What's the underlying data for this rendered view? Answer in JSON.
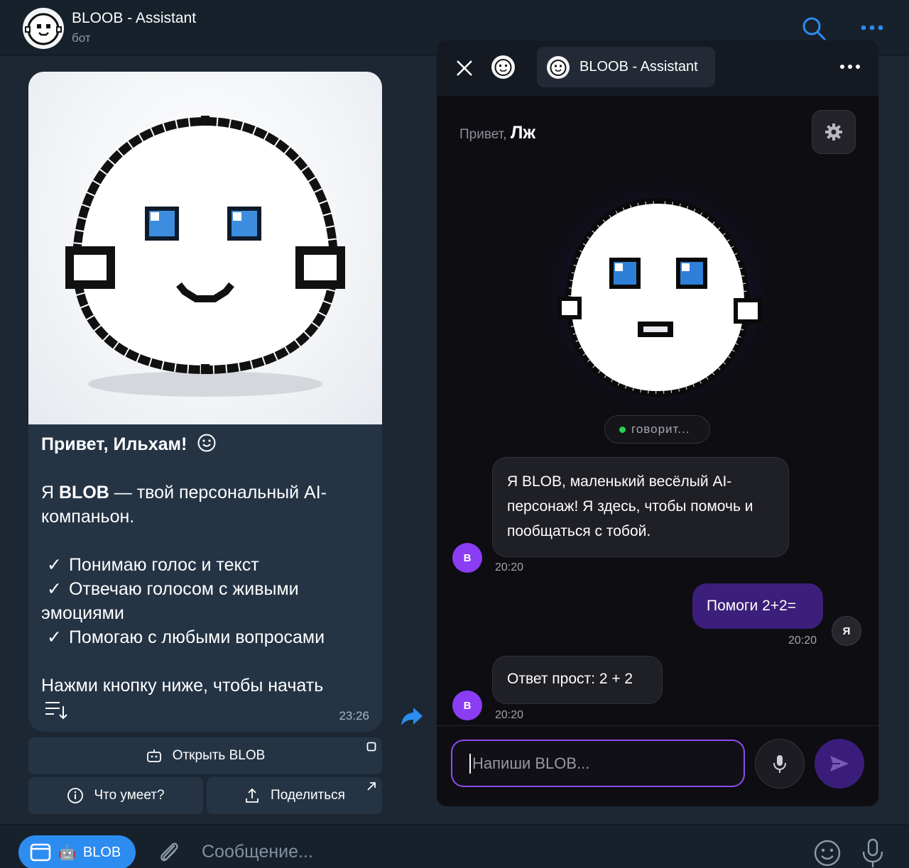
{
  "header": {
    "title": "BLOOB - Assistant",
    "subtitle": "бот",
    "icons": [
      "search-icon",
      "more-icon"
    ]
  },
  "message": {
    "greeting": "Привет, Ильхам!",
    "intro_prefix": "Я ",
    "intro_bold": "BLOB",
    "intro_suffix": " — твой персональный AI-компаньон.",
    "features": [
      "Понимаю голос и текст",
      "Отвечаю голосом с живыми эмоциями",
      "Помогаю с любыми вопросами"
    ],
    "cta": "Нажми кнопку ниже, чтобы начать",
    "time": "23:26"
  },
  "buttons": {
    "open": "Открыть BLOB",
    "about": "Что умеет?",
    "share": "Поделиться"
  },
  "miniapp": {
    "title": "BLOOB - Assistant",
    "hello_prefix": "Привет,",
    "hello_name": "Лж",
    "status": "говорит...",
    "messages": [
      {
        "from": "bot",
        "avatar": "B",
        "text": "Я BLOB, маленький весёлый AI-персонаж! Я здесь, чтобы помочь и пообщаться с тобой.",
        "time": "20:20"
      },
      {
        "from": "user",
        "avatar": "Я",
        "text": "Помоги 2+2=",
        "time": "20:20"
      },
      {
        "from": "bot",
        "avatar": "B",
        "text": "Ответ прост: 2 + 2",
        "time": "20:20"
      }
    ],
    "input_placeholder": "Напиши BLOB..."
  },
  "composer": {
    "app_button": "BLOB",
    "app_button_emoji": "🤖",
    "placeholder": "Сообщение..."
  },
  "colors": {
    "accent": "#2d8cf0",
    "purple": "#8a3df2",
    "user_bubble": "#3b1f7a",
    "online": "#27d14e"
  }
}
